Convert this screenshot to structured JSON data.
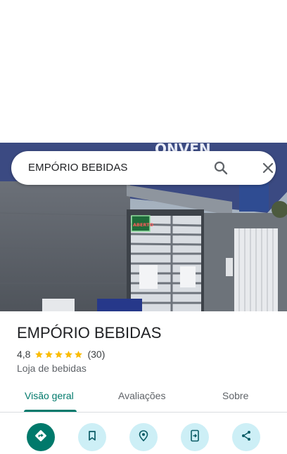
{
  "search": {
    "query": "EMPÓRIO BEBIDAS"
  },
  "icons": {
    "search": "search-icon",
    "close": "close-icon",
    "directions": "directions-icon",
    "save": "bookmark-icon",
    "nearby": "nearby-icon",
    "send_to_phone": "send-to-phone-icon",
    "share": "share-icon"
  },
  "place": {
    "name": "EMPÓRIO BEBIDAS",
    "rating": "4,8",
    "stars": 5,
    "review_count": "(30)",
    "category": "Loja de bebidas",
    "storefront_sign": "ABERTO"
  },
  "tabs": [
    {
      "label": "Visão geral",
      "active": true
    },
    {
      "label": "Avaliações",
      "active": false
    },
    {
      "label": "Sobre",
      "active": false
    }
  ],
  "colors": {
    "accent": "#00796b",
    "action_bg": "#cdeff6",
    "star": "#fbbc04"
  }
}
